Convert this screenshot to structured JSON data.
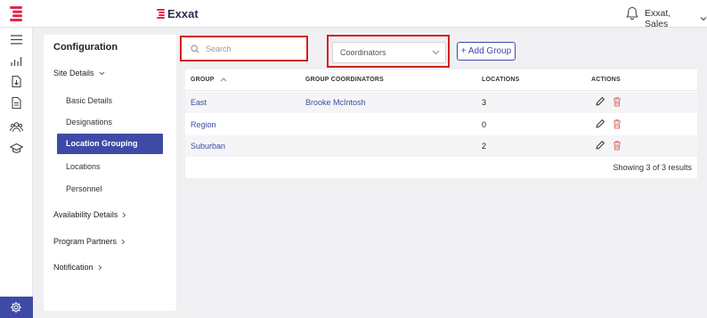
{
  "topbar": {
    "brand": "Exxat",
    "user": "Exxat, Sales",
    "accent": "#e0284f"
  },
  "rail": {
    "icons": [
      "menu-icon",
      "analytics-icon",
      "document-download-icon",
      "document-list-icon",
      "people-group-icon",
      "graduation-cap-icon"
    ],
    "settings_icon": "gear-icon"
  },
  "config": {
    "title": "Configuration",
    "sections": {
      "site_details": "Site Details",
      "items": [
        "Basic Details",
        "Designations",
        "Location Grouping",
        "Locations",
        "Personnel"
      ],
      "active_item": "Location Grouping",
      "availability": "Availability Details",
      "program_partners": "Program Partners",
      "notification": "Notification"
    }
  },
  "toolbar": {
    "search_placeholder": "Search",
    "coordinators_value": "Coordinators",
    "add_group_label": "+ Add Group"
  },
  "table": {
    "headers": [
      "GROUP",
      "GROUP COORDINATORS",
      "LOCATIONS",
      "ACTIONS"
    ],
    "rows": [
      {
        "group": "East",
        "coordinators": "Brooke McIntosh",
        "locations": "3"
      },
      {
        "group": "Region",
        "coordinators": "",
        "locations": "0"
      },
      {
        "group": "Suburban",
        "coordinators": "",
        "locations": "2"
      }
    ],
    "footer": "Showing 3 of 3 results"
  },
  "colors": {
    "primary": "#3f4aa6",
    "highlight_box": "#d12020",
    "delete_icon": "#e07070"
  }
}
